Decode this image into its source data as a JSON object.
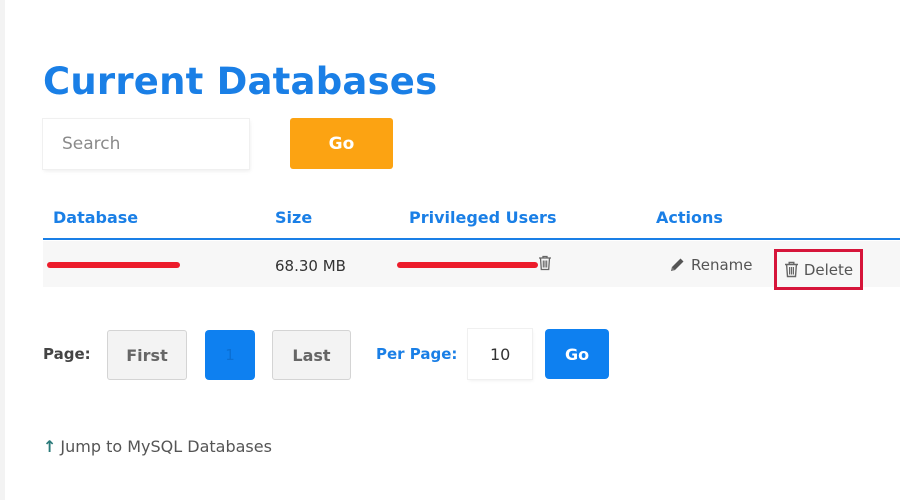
{
  "page": {
    "title": "Current Databases"
  },
  "search": {
    "placeholder": "Search",
    "value": "",
    "go_label": "Go"
  },
  "table": {
    "columns": [
      "Database",
      "Size",
      "Privileged Users",
      "Actions"
    ],
    "rows": [
      {
        "database": "",
        "size": "68.30 MB",
        "privileged_users": "",
        "actions": {
          "rename_label": "Rename",
          "delete_label": "Delete"
        }
      }
    ]
  },
  "pagination": {
    "page_label": "Page:",
    "first_label": "First",
    "current_page": "1",
    "last_label": "Last",
    "per_page_label": "Per Page:",
    "per_page_value": "10",
    "go_label": "Go"
  },
  "footer": {
    "jump_label": "Jump to MySQL Databases"
  },
  "colors": {
    "accent": "#1a7fe6",
    "search_go": "#fca312",
    "primary_button": "#0e80f0",
    "highlight_box": "#d6153a",
    "redaction": "#ec1c2b"
  },
  "icons": {
    "rename": "pencil-icon",
    "delete": "trash-icon",
    "user_remove": "trash-icon",
    "jump": "arrow-up-icon"
  }
}
